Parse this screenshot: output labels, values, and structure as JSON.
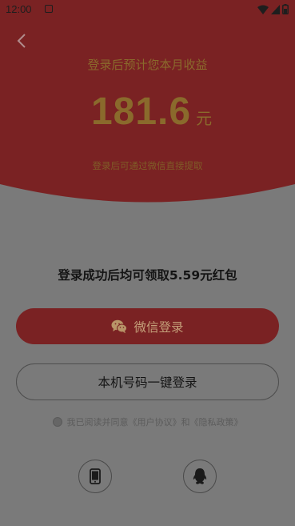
{
  "status_bar": {
    "time": "12:00"
  },
  "hero": {
    "estimate_label": "登录后预计您本月收益",
    "amount": "181.6",
    "unit": "元",
    "note": "登录后可通过微信直接提取"
  },
  "promo": {
    "redpacket_text": "登录成功后均可领取5.59元红包"
  },
  "buttons": {
    "wechat_label": "微信登录",
    "phone_label": "本机号码一键登录"
  },
  "agreement": {
    "prefix": "我已阅读并同意",
    "user_agreement": "《用户协议》",
    "and": "和",
    "privacy_policy": "《隐私政策》"
  },
  "colors": {
    "hero_red": "#7a2223",
    "gold_text": "#8a6a2c",
    "overlay_gray": "#7a7a7a"
  },
  "icons": {
    "back": "back-arrow-icon",
    "wechat": "wechat-icon",
    "phone": "phone-icon",
    "qq": "qq-icon"
  }
}
